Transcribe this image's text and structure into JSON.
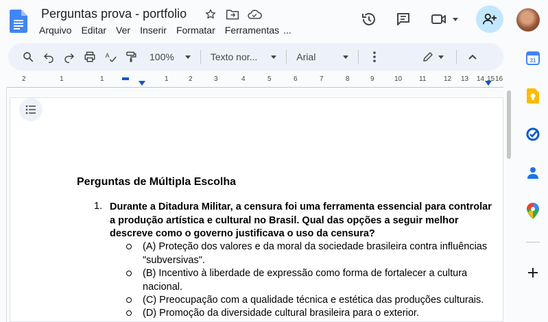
{
  "app": {
    "document_title": "Perguntas prova - portfolio"
  },
  "menu": {
    "items": [
      "Arquivo",
      "Editar",
      "Ver",
      "Inserir",
      "Formatar",
      "Ferramentas",
      "..."
    ]
  },
  "toolbar": {
    "zoom": "100%",
    "style": "Texto nor...",
    "font": "Arial"
  },
  "ruler": {
    "labels": [
      "2",
      "1",
      "1",
      "1",
      "2",
      "3",
      "4",
      "5",
      "6",
      "7",
      "8",
      "9",
      "10",
      "11",
      "12",
      "13",
      "14",
      "15",
      "16"
    ]
  },
  "document": {
    "heading": "Perguntas de Múltipla Escolha",
    "question": {
      "number": "1.",
      "text": "Durante a Ditadura Militar, a censura foi uma ferramenta essencial para controlar a produção artística e cultural no Brasil. Qual das opções a seguir melhor descreve como o governo justificava o uso da censura?",
      "options": [
        "(A) Proteção dos valores e da moral da sociedade brasileira contra influências \"subversivas\".",
        "(B) Incentivo à liberdade de expressão como forma de fortalecer a cultura nacional.",
        "(C) Preocupação com a qualidade técnica e estética das produções culturais.",
        "(D) Promoção da diversidade cultural brasileira para o exterior."
      ]
    }
  },
  "colors": {
    "accent": "#0b57d0",
    "share_bg": "#c2e7ff",
    "toolbar_bg": "#edf2fa"
  }
}
